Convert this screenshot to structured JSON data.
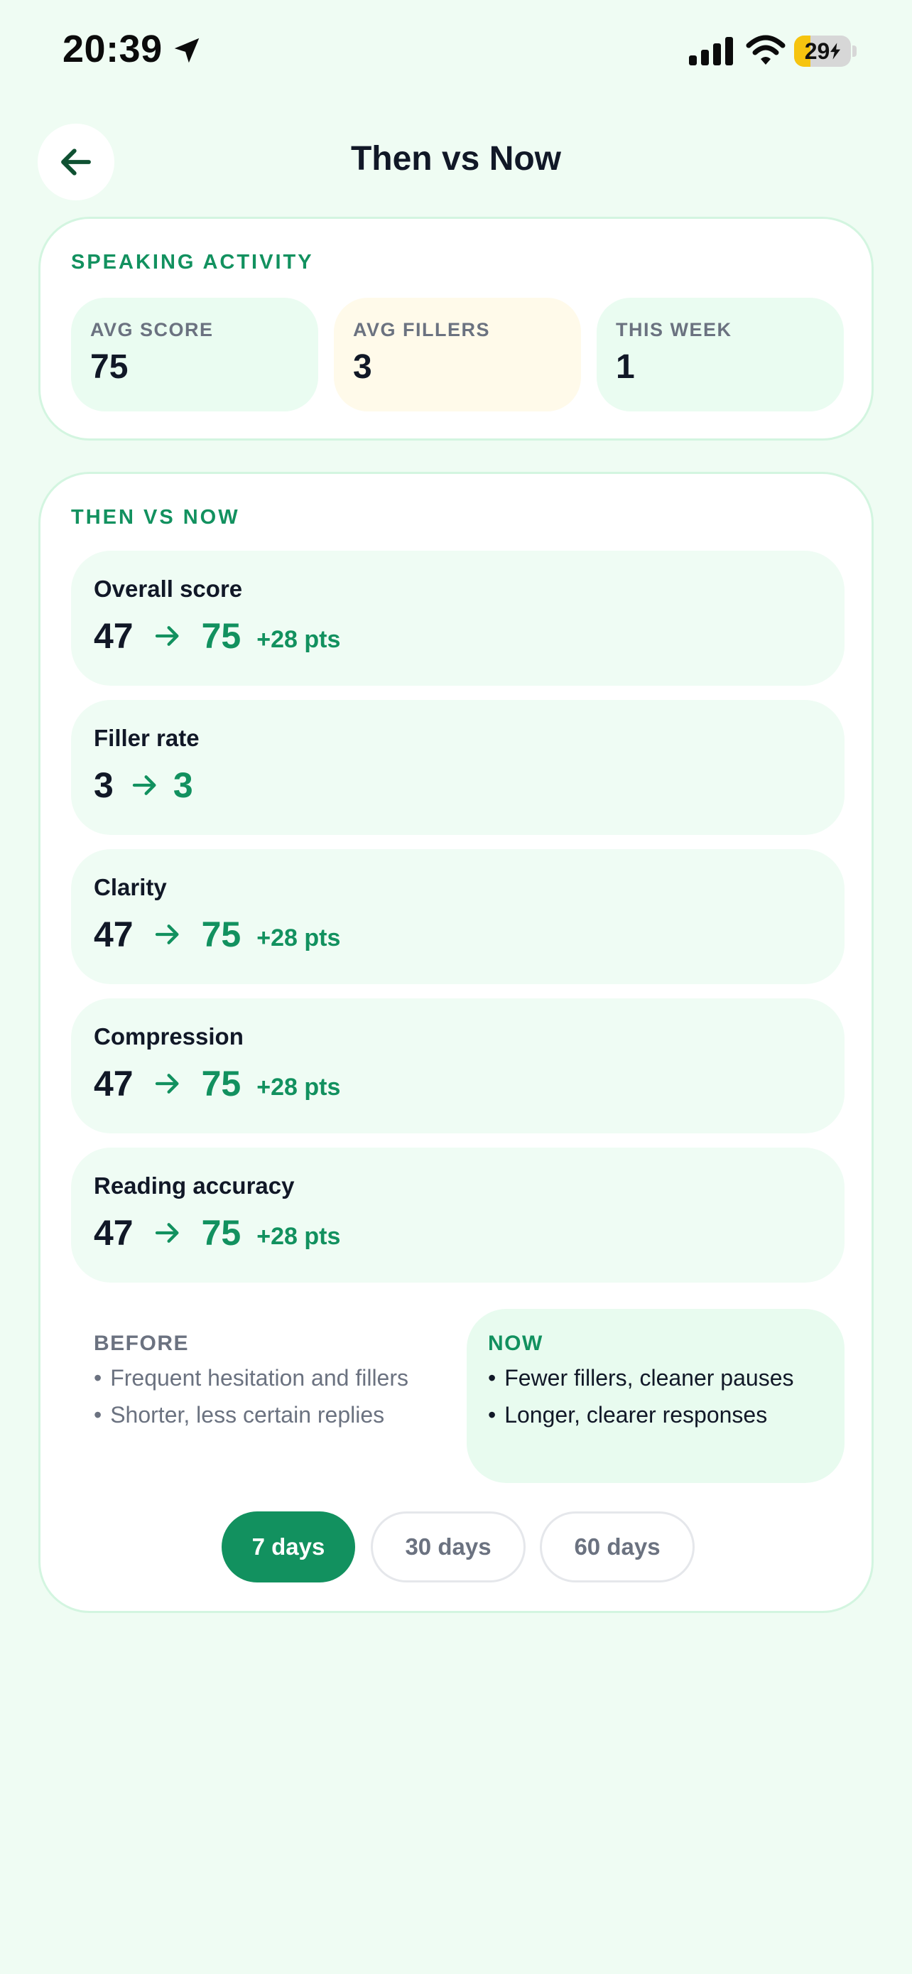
{
  "status_bar": {
    "time": "20:39",
    "battery_level": "29",
    "battery_fraction": 0.29,
    "battery_color": "#f6c40f"
  },
  "header": {
    "title": "Then vs Now",
    "back_icon": "arrow-left-icon"
  },
  "activity": {
    "title": "SPEAKING ACTIVITY",
    "stats": [
      {
        "label": "AVG SCORE",
        "value": "75"
      },
      {
        "label": "AVG FILLERS",
        "value": "3"
      },
      {
        "label": "THIS WEEK",
        "value": "1"
      }
    ]
  },
  "compare": {
    "title": "THEN VS NOW",
    "metrics": [
      {
        "label": "Overall score",
        "before": "47",
        "after": "75",
        "delta": "+28 pts"
      },
      {
        "label": "Filler rate",
        "before": "3",
        "after": "3",
        "delta": ""
      },
      {
        "label": "Clarity",
        "before": "47",
        "after": "75",
        "delta": "+28 pts"
      },
      {
        "label": "Compression",
        "before": "47",
        "after": "75",
        "delta": "+28 pts"
      },
      {
        "label": "Reading accuracy",
        "before": "47",
        "after": "75",
        "delta": "+28 pts"
      }
    ],
    "before": {
      "title": "BEFORE",
      "items": [
        "Frequent hesitation and fillers",
        "Shorter, less certain replies"
      ]
    },
    "now": {
      "title": "NOW",
      "items": [
        "Fewer fillers, cleaner pauses",
        "Longer, clearer responses"
      ]
    },
    "ranges": [
      "7 days",
      "30 days",
      "60 days"
    ],
    "selected_range": "7 days"
  },
  "colors": {
    "accent": "#12915f",
    "background": "#effcf3",
    "stat_warn_bg": "#fffaea"
  }
}
